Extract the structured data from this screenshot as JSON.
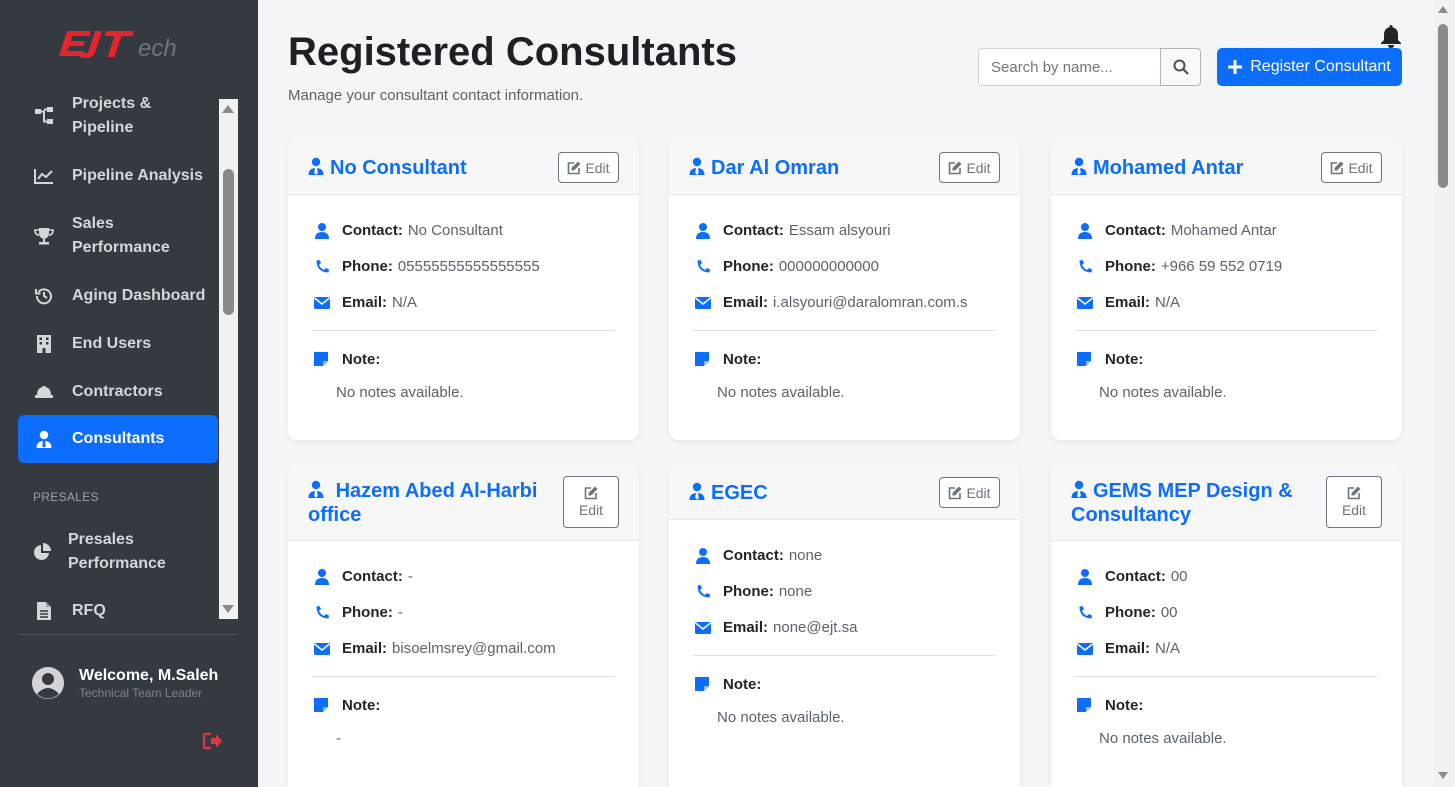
{
  "app": {
    "logo_text": "EJTech"
  },
  "sidebar": {
    "items": [
      {
        "label_line1": "Projects &",
        "label_line2": "Pipeline",
        "icon": "sitemap-icon"
      },
      {
        "label": "Pipeline Analysis",
        "icon": "chart-line-icon"
      },
      {
        "label_line1": "Sales",
        "label_line2": "Performance",
        "icon": "trophy-icon"
      },
      {
        "label": "Aging Dashboard",
        "icon": "history-icon"
      },
      {
        "label": "End Users",
        "icon": "building-icon"
      },
      {
        "label": "Contractors",
        "icon": "hard-hat-icon"
      },
      {
        "label": "Consultants",
        "icon": "user-tie-icon",
        "active": true
      },
      {
        "label_line1": "Presales",
        "label_line2": "Performance",
        "icon": "pie-chart-icon"
      },
      {
        "label": "RFQ",
        "icon": "file-icon"
      }
    ],
    "section_presales": "PRESALES",
    "user": {
      "name": "Welcome, M.Saleh",
      "role": "Technical Team Leader"
    }
  },
  "header": {
    "title": "Registered Consultants",
    "subtitle": "Manage your consultant contact information.",
    "search_placeholder": "Search by name...",
    "register_label": "Register Consultant"
  },
  "labels": {
    "contact": "Contact:",
    "phone": "Phone:",
    "email": "Email:",
    "note": "Note:",
    "edit": "Edit"
  },
  "consultants": [
    {
      "name": "No Consultant",
      "contact": "No Consultant",
      "phone": "05555555555555555",
      "email": "N/A",
      "note": "No notes available."
    },
    {
      "name": "Dar Al Omran",
      "contact": "Essam alsyouri",
      "phone": "000000000000",
      "email": "i.alsyouri@daralomran.com.s",
      "note": "No notes available."
    },
    {
      "name": "Mohamed Antar",
      "contact": "Mohamed Antar",
      "phone": "+966 59 552 0719",
      "email": "N/A",
      "note": "No notes available."
    },
    {
      "name_line1": "Hazem Abed Al-Harbi",
      "name_line2": "office",
      "contact": "-",
      "phone": "-",
      "email": "bisoelmsrey@gmail.com",
      "note": "-"
    },
    {
      "name": "EGEC",
      "contact": "none",
      "phone": "none",
      "email": "none@ejt.sa",
      "note": "No notes available."
    },
    {
      "name_line1": "GEMS MEP Design &",
      "name_line2": "Consultancy",
      "contact": "00",
      "phone": "00",
      "email": "N/A",
      "note": "No notes available."
    }
  ],
  "colors": {
    "primary": "#0d6efd",
    "sidebar_bg": "#343a40",
    "logo_red": "#e3262e",
    "logout_red": "#dc3545"
  }
}
